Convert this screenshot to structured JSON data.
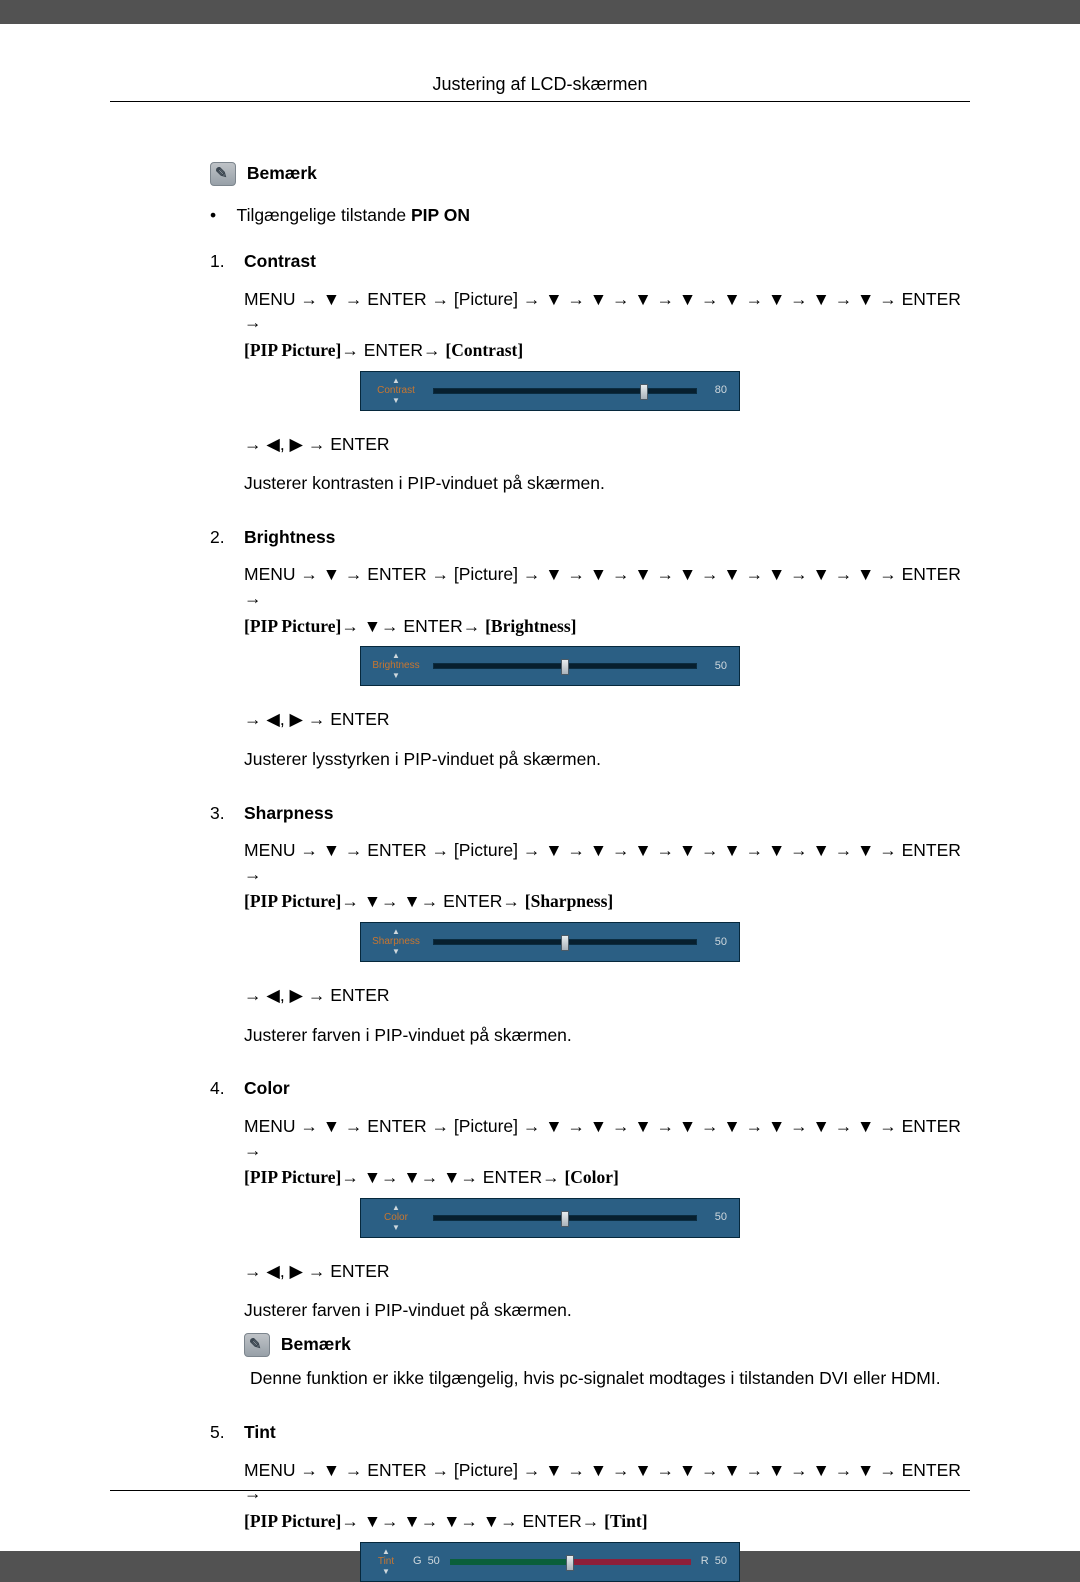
{
  "header": {
    "title": "Justering af LCD-skærmen"
  },
  "notice_label": "Bemærk",
  "bullet": {
    "text_prefix": "Tilgængelige tilstande ",
    "text_bold": "PIP ON"
  },
  "arrow": "→",
  "down": "▼",
  "left": "◀",
  "right": "▶",
  "menu": "MENU",
  "enter": "ENTER",
  "picture": "[Picture]",
  "pip_picture": "[PIP Picture]",
  "comma_nav": "→ ◀, ▶ → ENTER",
  "items": [
    {
      "num": "1.",
      "label": "Contrast",
      "path1": "MENU → ▼ → ENTER → [Picture] → ▼ → ▼ → ▼ → ▼ → ▼ → ▼ → ▼ → ▼ → ENTER →",
      "path2": "[PIP Picture]→ ENTER→ [Contrast]",
      "bracket": "[Contrast]",
      "slider": {
        "name": "Contrast",
        "value": 80,
        "percent": 80
      },
      "desc": "Justerer kontrasten i PIP-vinduet på skærmen."
    },
    {
      "num": "2.",
      "label": "Brightness",
      "path1": "MENU → ▼ → ENTER → [Picture] → ▼ → ▼ → ▼ → ▼ → ▼ → ▼ → ▼ → ▼ → ENTER →",
      "path2": "[PIP Picture]→ ▼→ ENTER→ [Brightness]",
      "bracket": "[Brightness]",
      "slider": {
        "name": "Brightness",
        "value": 50,
        "percent": 50
      },
      "desc": "Justerer lysstyrken i PIP-vinduet på skærmen."
    },
    {
      "num": "3.",
      "label": "Sharpness",
      "path1": "MENU → ▼ → ENTER → [Picture] → ▼ → ▼ → ▼ → ▼ → ▼ → ▼ → ▼ → ▼ → ENTER →",
      "path2": "[PIP Picture]→ ▼→ ▼→ ENTER→ [Sharpness]",
      "bracket": "[Sharpness]",
      "slider": {
        "name": "Sharpness",
        "value": 50,
        "percent": 50
      },
      "desc": "Justerer farven i PIP-vinduet på skærmen."
    },
    {
      "num": "4.",
      "label": "Color",
      "path1": "MENU → ▼ → ENTER → [Picture] → ▼ → ▼ → ▼ → ▼ → ▼ → ▼ → ▼ → ▼ → ENTER →",
      "path2": "[PIP Picture]→ ▼→ ▼→ ▼→ ENTER→ [Color]",
      "bracket": "[Color]",
      "slider": {
        "name": "Color",
        "value": 50,
        "percent": 50
      },
      "desc": "Justerer farven i PIP-vinduet på skærmen.",
      "note": "Denne funktion er ikke tilgængelig, hvis pc-signalet modtages i tilstanden DVI eller HDMI."
    },
    {
      "num": "5.",
      "label": "Tint",
      "path1": "MENU → ▼ → ENTER → [Picture] → ▼ → ▼ → ▼ → ▼ → ▼ → ▼ → ▼ → ▼ → ENTER →",
      "path2": "[PIP Picture]→ ▼→ ▼→ ▼→ ▼→ ENTER→ [Tint]",
      "bracket": "[Tint]",
      "tint_slider": {
        "name": "Tint",
        "g_label": "G",
        "g_value": 50,
        "r_label": "R",
        "r_value": 50,
        "percent": 50
      }
    }
  ]
}
